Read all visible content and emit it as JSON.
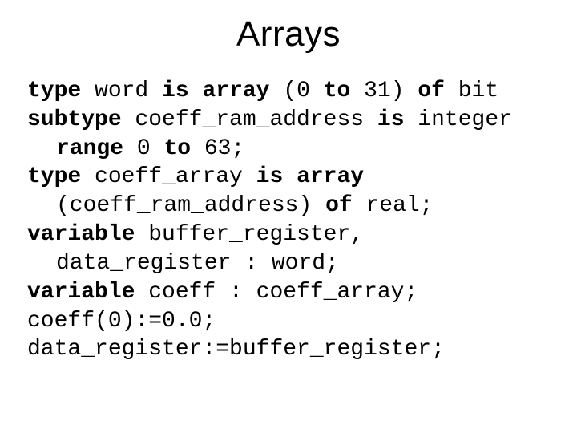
{
  "title": "Arrays",
  "kw": {
    "type": "type",
    "is": "is",
    "array": "array",
    "to": "to",
    "of": "of",
    "subtype": "subtype",
    "range": "range",
    "variable": "variable"
  },
  "t": {
    "l1a": " word ",
    "l1b": " (0 ",
    "l1c": " 31) ",
    "l1d": " bit",
    "l2a": " coeff_ram_address ",
    "l2b": " integer ",
    "l2c": " 0 ",
    "l2d": " 63;",
    "l3a": " coeff_array ",
    "l3b": " (coeff_ram_address) ",
    "l3c": " real;",
    "l4a": " buffer_register, data_register : word;",
    "l5a": " coeff : coeff_array;",
    "l6": "coeff(0):=0.0;",
    "l7": "data_register:=buffer_register;"
  }
}
